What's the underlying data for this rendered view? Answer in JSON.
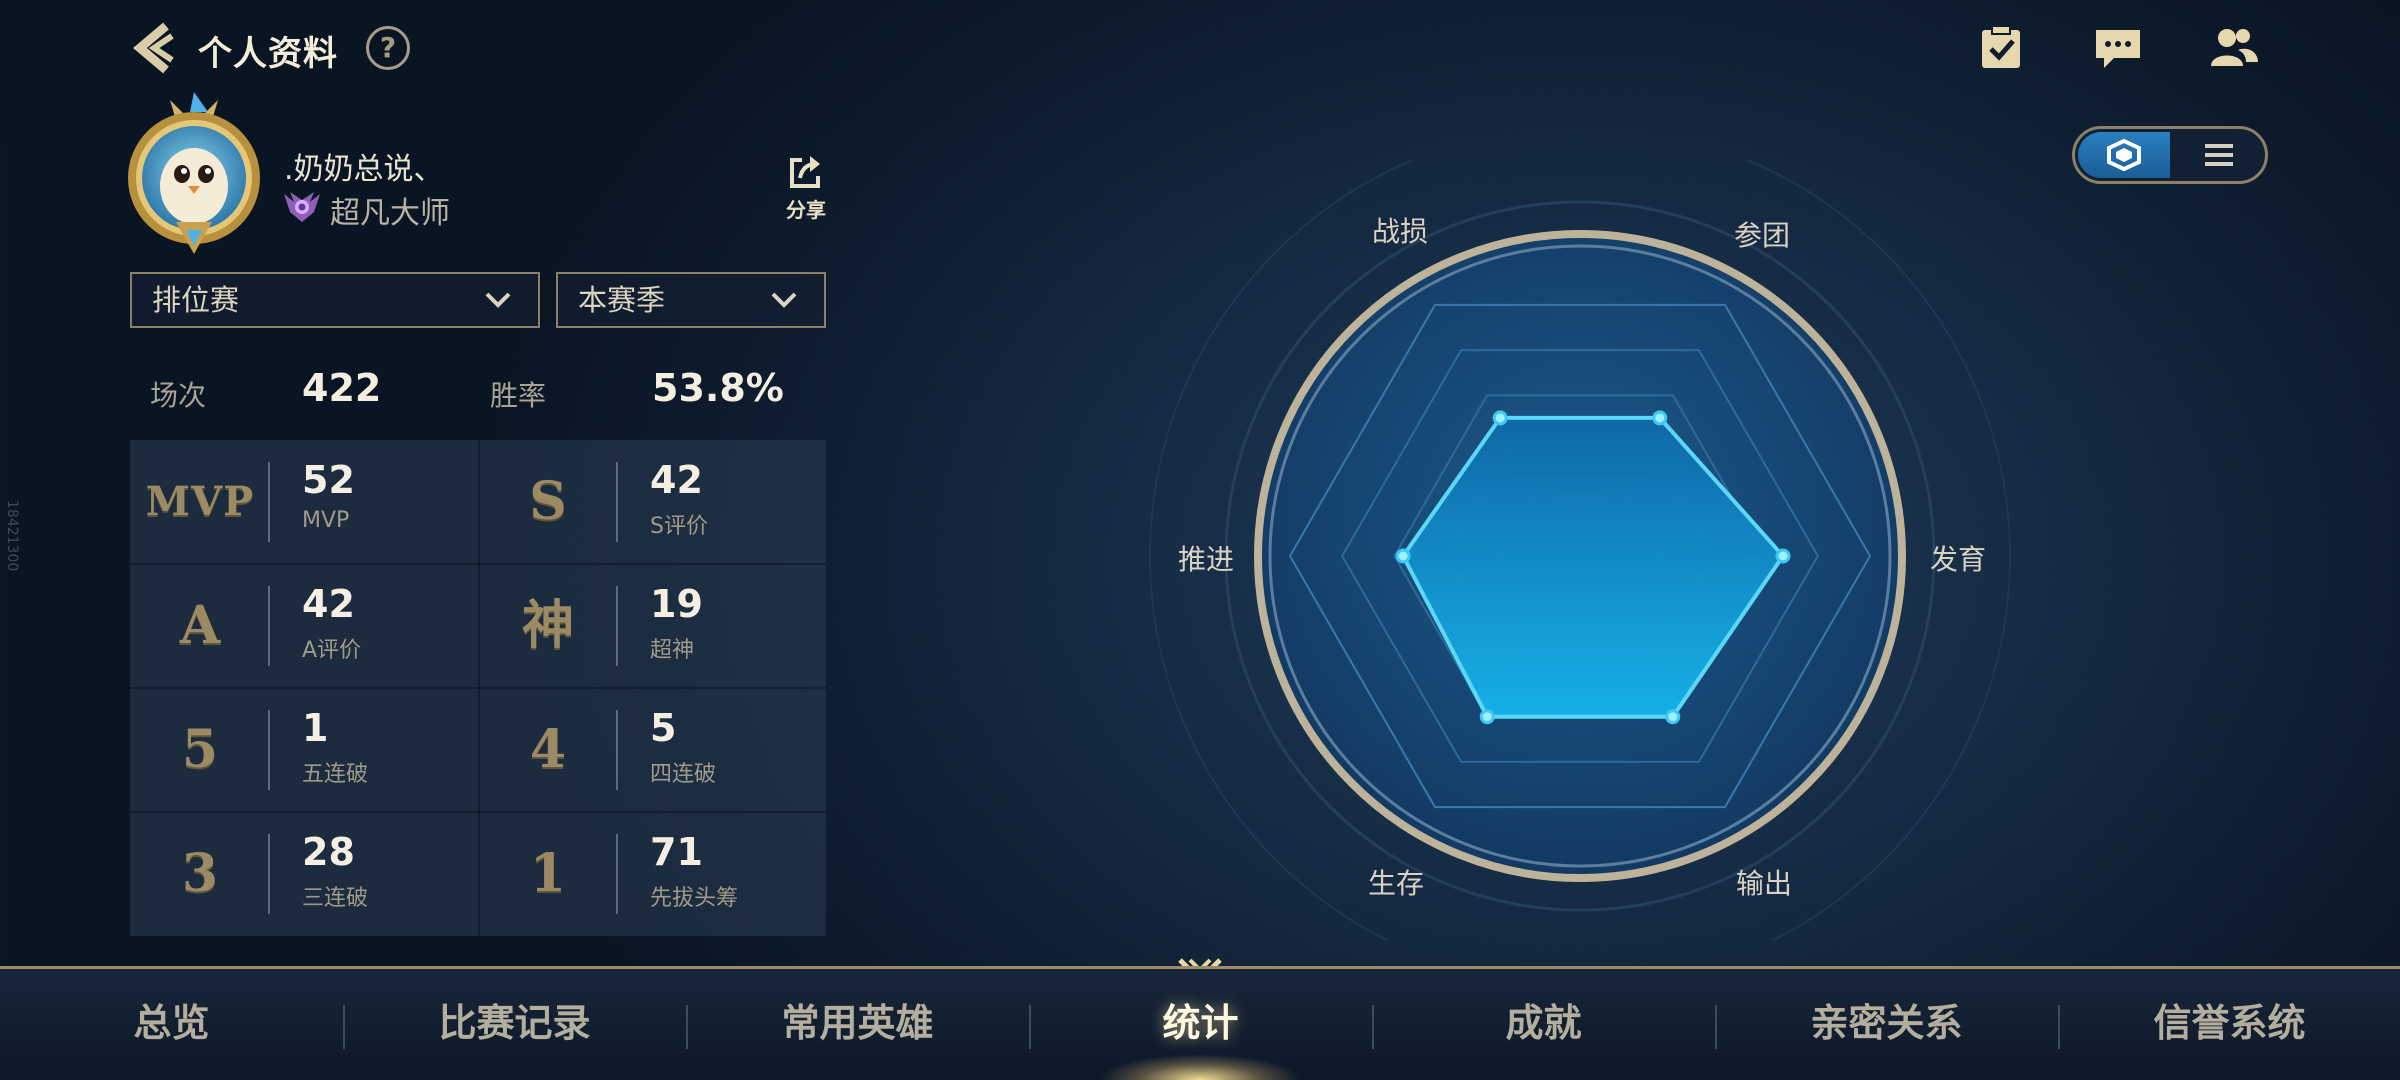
{
  "header": {
    "title": "个人资料",
    "help": "?"
  },
  "profile": {
    "name": ".奶奶总说、",
    "rank": "超凡大师",
    "share_label": "分享"
  },
  "filters": {
    "mode": "排位赛",
    "season": "本赛季"
  },
  "summary": {
    "games_label": "场次",
    "games_value": "422",
    "winrate_label": "胜率",
    "winrate_value": "53.8%"
  },
  "stats": [
    {
      "badge": "MVP",
      "value": "52",
      "caption": "MVP"
    },
    {
      "badge": "S",
      "value": "42",
      "caption": "S评价"
    },
    {
      "badge": "A",
      "value": "42",
      "caption": "A评价"
    },
    {
      "badge": "神",
      "value": "19",
      "caption": "超神"
    },
    {
      "badge": "5",
      "value": "1",
      "caption": "五连破"
    },
    {
      "badge": "4",
      "value": "5",
      "caption": "四连破"
    },
    {
      "badge": "3",
      "value": "28",
      "caption": "三连破"
    },
    {
      "badge": "1",
      "value": "71",
      "caption": "先拔头筹"
    }
  ],
  "radar": {
    "labels": {
      "zhansun": "战损",
      "cantuan": "参团",
      "fayu": "发育",
      "shuchu": "输出",
      "shengcun": "生存",
      "tuijin": "推进"
    },
    "values": {
      "参团": 0.55,
      "发育": 0.7,
      "输出": 0.64,
      "生存": 0.64,
      "推进": 0.61,
      "战损": 0.55
    },
    "accent": "#3fc8f5"
  },
  "tabs": [
    "总览",
    "比赛记录",
    "常用英雄",
    "统计",
    "成就",
    "亲密关系",
    "信誉系统"
  ],
  "active_tab": "统计",
  "side_id": "18421300"
}
